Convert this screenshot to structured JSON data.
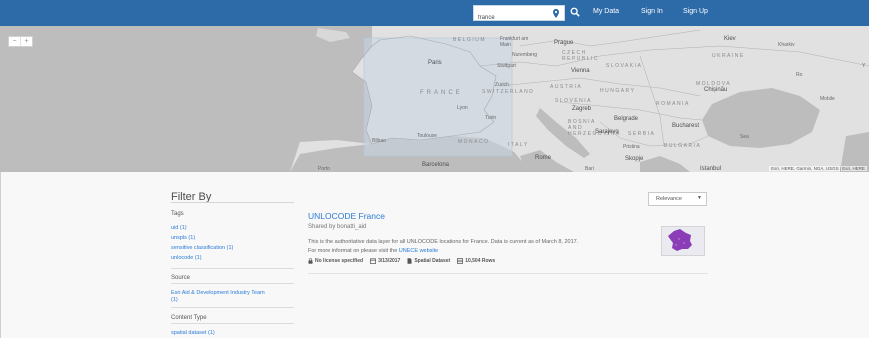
{
  "header": {
    "search_value": "france",
    "links": [
      "My Data",
      "Sign In",
      "Sign Up"
    ]
  },
  "map": {
    "zoom_in": "+",
    "zoom_out": "−",
    "labels": {
      "belgium": "BELGIUM",
      "frankfurt": "Frankfurt am Main",
      "prague": "Prague",
      "nuremberg": "Nuremberg",
      "czech": "CZECH REPUBLIC",
      "kiev": "Kiev",
      "kharkiv": "Kharkiv",
      "ukraine": "UKRAINE",
      "paris": "Paris",
      "stuttgart": "Stuttgart",
      "slovakia": "SLOVAKIA",
      "vienna": "Vienna",
      "france": "FRANCE",
      "zurich": "Zurich",
      "switzerland": "SWITZERLAND",
      "austria": "AUSTRIA",
      "hungary": "HUNGARY",
      "moldova": "MOLDOVA",
      "chisinau": "Chișinău",
      "lyon": "Lyon",
      "slovenia": "SLOVENIA",
      "zagreb": "Zagreb",
      "croatia": "CROATIA",
      "romania": "ROMANIA",
      "turin": "Turin",
      "bosnia": "BOSNIA AND HERZEGOVINA",
      "belgrade": "Belgrade",
      "bucharest": "Bucharest",
      "toulouse": "Toulouse",
      "monaco": "MONACO",
      "sarajevo": "Sarajevo",
      "serbia": "SERBIA",
      "bilbao": "Bilbao",
      "italy": "ITALY",
      "pristina": "Pristina",
      "bulgaria": "BULGARIA",
      "rome": "Rome",
      "skopje": "Skopje",
      "barcelona": "Barcelona",
      "bari": "Bari",
      "istanbul": "Istanbul",
      "porto": "Porto",
      "ro": "Ro",
      "y": "Y",
      "mobile": "Mobile",
      "sea": "Sea"
    },
    "attribution": "Esri, HERE, Garmin, NGA, USGS | Esri, HERE"
  },
  "filters": {
    "title": "Filter By",
    "tags_label": "Tags",
    "tags": [
      "uid (1)",
      "unspls (1)",
      "sensitive classification (1)",
      "unlocode (1)"
    ],
    "source_label": "Source",
    "source_items": [
      "Esri Aid & Development Industry Team",
      "(1)"
    ],
    "content_type_label": "Content Type",
    "content_types": [
      "spatial dataset (1)"
    ]
  },
  "sort": {
    "value": "Relevance",
    "caret": "▼"
  },
  "result": {
    "title": "UNLOCODE France",
    "owner": "Shared by bonatti_aid",
    "description": "This is the authoritative data layer for all UNLOCODE locations for France.  Data is current as of March 8, 2017.",
    "more_info_prefix": "For more informat on please visit the ",
    "more_info_link": "UNECE website",
    "meta": {
      "license": "No license specified",
      "date": "3/13/2017",
      "type": "Spatial Dataset",
      "rows": "10,504 Rows"
    }
  },
  "colors": {
    "header": "#2c6aa8",
    "link": "#2c7bd6",
    "map_land": "#e1e1e1",
    "map_water": "#bdbdbd",
    "extent": "#c8d6e3",
    "thumb_france": "#8a3db7"
  }
}
